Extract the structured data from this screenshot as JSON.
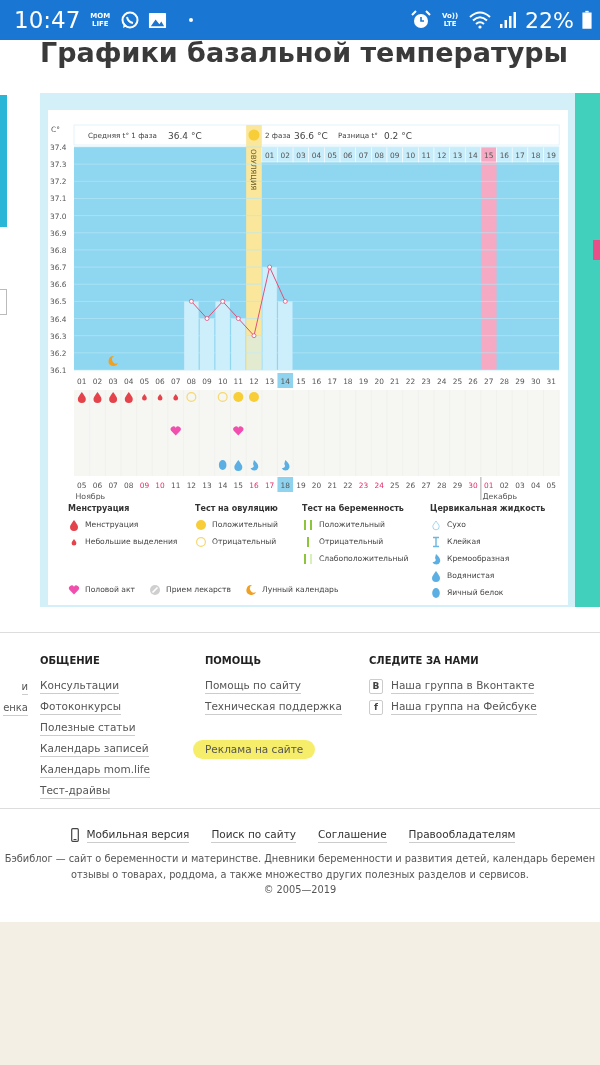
{
  "status_bar": {
    "time": "10:47",
    "app_badge": "MOM LIFE",
    "network_badge": "Vo)) LTE",
    "battery": "22%"
  },
  "page_title": "Графики базальной температуры",
  "chart": {
    "phase1": {
      "label": "Средняя t° 1 фаза",
      "value": "36.4 °C"
    },
    "phase2": {
      "label": "2 фаза",
      "value": "36.6 °C"
    },
    "difference": {
      "label": "Разница t°",
      "value": "0.2 °C"
    },
    "chart_data": {
      "type": "bar",
      "ylabel": "C°",
      "grid": true,
      "categories": [
        "01",
        "02",
        "03",
        "04",
        "05",
        "06",
        "07",
        "08",
        "09",
        "10",
        "11",
        "12",
        "13",
        "14",
        "15",
        "16",
        "17",
        "18",
        "19",
        "20",
        "21",
        "22",
        "23",
        "24",
        "25",
        "26",
        "27",
        "28",
        "29",
        "30",
        "31"
      ],
      "series": [
        {
          "color": "#cdeefb",
          "values": [
            null,
            null,
            null,
            null,
            null,
            null,
            null,
            36.5,
            36.4,
            36.5,
            36.4,
            36.3,
            36.7,
            36.5,
            null,
            null,
            null,
            null,
            null,
            null,
            null,
            null,
            null,
            null,
            null,
            null,
            null,
            null,
            null,
            null,
            null
          ]
        }
      ],
      "bands": [
        {
          "axis": "x",
          "from": "12",
          "to": "12",
          "color": "#fbe79c",
          "label": "ОВУЛЯЦИЯ"
        },
        {
          "axis": "x",
          "from": "27",
          "to": "27",
          "color": "#f5a9c2"
        }
      ],
      "ylim": [
        36.1,
        37.4
      ],
      "yticks": [
        36.1,
        36.2,
        36.3,
        36.4,
        36.5,
        36.6,
        36.7,
        36.8,
        36.9,
        {
          "value": 37.0,
          "label": "37.0"
        },
        37.1,
        37.2,
        37.3,
        37.4
      ]
    },
    "days": [
      {
        "date": "05",
        "month": "Ноябрь",
        "holiday": false,
        "today": false,
        "marks": [
          {
            "kind": "drop_large"
          }
        ]
      },
      {
        "date": "06",
        "holiday": false,
        "today": false,
        "marks": [
          {
            "kind": "drop_large"
          }
        ]
      },
      {
        "date": "07",
        "holiday": false,
        "today": false,
        "marks": [
          {
            "kind": "drop_large"
          },
          {
            "kind": "moon"
          }
        ]
      },
      {
        "date": "08",
        "holiday": false,
        "today": false,
        "marks": [
          {
            "kind": "drop_large"
          }
        ]
      },
      {
        "date": "09",
        "holiday": true,
        "today": false,
        "marks": [
          {
            "kind": "drop_small"
          }
        ]
      },
      {
        "date": "10",
        "holiday": true,
        "today": false,
        "marks": [
          {
            "kind": "drop_small"
          }
        ]
      },
      {
        "date": "11",
        "holiday": false,
        "today": false,
        "marks": [
          {
            "kind": "drop_small"
          },
          {
            "kind": "heart"
          }
        ]
      },
      {
        "date": "12",
        "holiday": false,
        "today": false,
        "marks": [
          {
            "kind": "circle_outline"
          }
        ]
      },
      {
        "date": "13",
        "holiday": false,
        "today": false
      },
      {
        "date": "14",
        "holiday": false,
        "today": false,
        "marks": [
          {
            "kind": "circle_outline"
          },
          {
            "kind": "egg_white"
          }
        ]
      },
      {
        "date": "15",
        "holiday": false,
        "today": false,
        "marks": [
          {
            "kind": "circle_filled"
          },
          {
            "kind": "heart"
          },
          {
            "kind": "watery"
          }
        ]
      },
      {
        "date": "16",
        "holiday": true,
        "today": false,
        "marks": [
          {
            "kind": "circle_filled"
          },
          {
            "kind": "creamy"
          }
        ]
      },
      {
        "date": "17",
        "holiday": true,
        "today": false,
        "phase2_day": "01"
      },
      {
        "date": "18",
        "holiday": false,
        "today": true,
        "phase2_day": "02",
        "marks": [
          {
            "kind": "creamy"
          }
        ]
      },
      {
        "date": "19",
        "holiday": false,
        "today": false,
        "phase2_day": "03"
      },
      {
        "date": "20",
        "holiday": false,
        "today": false,
        "phase2_day": "04"
      },
      {
        "date": "21",
        "holiday": false,
        "today": false,
        "phase2_day": "05"
      },
      {
        "date": "22",
        "holiday": false,
        "today": false,
        "phase2_day": "06"
      },
      {
        "date": "23",
        "holiday": true,
        "today": false,
        "phase2_day": "07"
      },
      {
        "date": "24",
        "holiday": true,
        "today": false,
        "phase2_day": "08"
      },
      {
        "date": "25",
        "holiday": false,
        "today": false,
        "phase2_day": "09"
      },
      {
        "date": "26",
        "holiday": false,
        "today": false,
        "phase2_day": "10"
      },
      {
        "date": "27",
        "holiday": false,
        "today": false,
        "phase2_day": "11"
      },
      {
        "date": "28",
        "holiday": false,
        "today": false,
        "phase2_day": "12"
      },
      {
        "date": "29",
        "holiday": false,
        "today": false,
        "phase2_day": "13"
      },
      {
        "date": "30",
        "holiday": true,
        "today": false,
        "phase2_day": "14"
      },
      {
        "date": "01",
        "month": "Декабрь",
        "holiday": true,
        "today": false,
        "phase2_day": "15"
      },
      {
        "date": "02",
        "holiday": false,
        "today": false,
        "phase2_day": "16"
      },
      {
        "date": "03",
        "holiday": false,
        "today": false,
        "phase2_day": "17"
      },
      {
        "date": "04",
        "holiday": false,
        "today": false,
        "phase2_day": "18"
      },
      {
        "date": "05",
        "holiday": false,
        "today": false,
        "phase2_day": "19"
      }
    ],
    "legend": {
      "sections": [
        {
          "title": "Менструация",
          "items": [
            {
              "kind": "drop_large",
              "label": "Менструация"
            },
            {
              "kind": "drop_small",
              "label": "Небольшие выделения"
            }
          ]
        },
        {
          "title": "Тест на овуляцию",
          "items": [
            {
              "kind": "circle_filled",
              "label": "Положительный"
            },
            {
              "kind": "circle_outline",
              "label": "Отрицательный"
            }
          ]
        },
        {
          "title": "Тест на беременность",
          "items": [
            {
              "kind": "two_bars",
              "label": "Положительный"
            },
            {
              "kind": "one_bar",
              "label": "Отрицательный"
            },
            {
              "kind": "faint_bar",
              "label": "Слабоположительный"
            }
          ]
        },
        {
          "title": "Цервикальная жидкость",
          "items": [
            {
              "kind": "dry",
              "label": "Сухо"
            },
            {
              "kind": "sticky",
              "label": "Клейкая"
            },
            {
              "kind": "creamy",
              "label": "Кремообразная"
            },
            {
              "kind": "watery",
              "label": "Водянистая"
            },
            {
              "kind": "egg_white",
              "label": "Яичный белок"
            }
          ]
        }
      ],
      "other": [
        {
          "kind": "heart",
          "label": "Половой акт"
        },
        {
          "kind": "pill",
          "label": "Прием лекарств"
        },
        {
          "kind": "moon",
          "label": "Лунный календарь"
        }
      ]
    }
  },
  "footer": {
    "cut_column": [
      "и",
      "енка"
    ],
    "columns": [
      {
        "title": "ОБЩЕНИЕ",
        "links": [
          {
            "label": "Консультации",
            "highlighted": false
          },
          {
            "label": "Фотоконкурсы",
            "highlighted": false
          },
          {
            "label": "Полезные статьи",
            "highlighted": false
          },
          {
            "label": "Календарь записей",
            "highlighted": false
          },
          {
            "label": "Календарь mom.life",
            "highlighted": false
          },
          {
            "label": "Тест-драйвы",
            "highlighted": false
          }
        ]
      },
      {
        "title": "ПОМОЩЬ",
        "links": [
          {
            "label": "Помощь по сайту",
            "highlighted": false
          },
          {
            "label": "Техническая поддержка",
            "highlighted": false
          },
          {
            "label": "Реклама на сайте",
            "highlighted": true
          }
        ]
      },
      {
        "title": "СЛЕДИТЕ ЗА НАМИ",
        "links": [
          {
            "label": "Наша группа в Вконтакте",
            "icon": "B",
            "highlighted": false
          },
          {
            "label": "Наша группа на Фейсбуке",
            "icon": "f",
            "highlighted": false
          }
        ]
      }
    ],
    "bottom_links": [
      "Мобильная версия",
      "Поиск по сайту",
      "Соглашение",
      "Правообладателям"
    ],
    "description_lines": [
      "Бэбиблог — сайт о беременности и материнстве. Дневники беременности и развития детей, календарь беремен",
      "отзывы о товарах, роддома, а также множество других полезных разделов и сервисов."
    ],
    "copyright": "© 2005—2019"
  }
}
